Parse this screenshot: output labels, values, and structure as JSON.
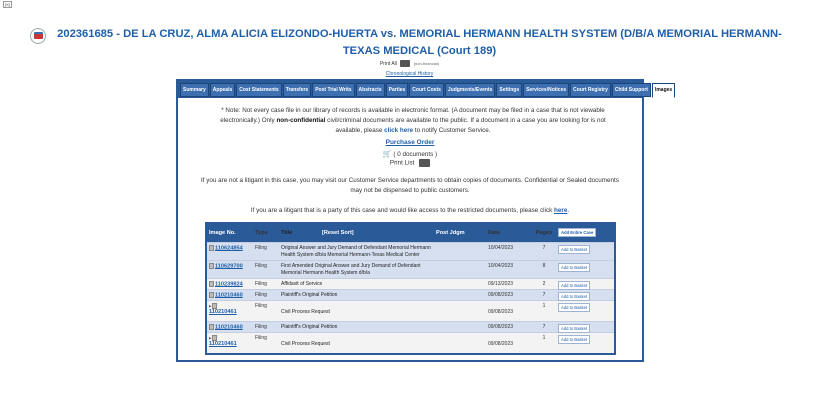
{
  "close_label": "[X]",
  "header": {
    "title": "202361685 - DE LA CRUZ, ALMA ALICIA ELIZONDO-HUERTA vs. MEMORIAL HERMANN HEALTH SYSTEM (D/B/A MEMORIAL HERMANN-TEXAS MEDICAL (Court 189)",
    "print_all": "Print All",
    "print_all_note": "(non-financial)",
    "chronological_history": "Chronological History"
  },
  "tabs": [
    {
      "label": "Summary"
    },
    {
      "label": "Appeals"
    },
    {
      "label": "Cost Statements"
    },
    {
      "label": "Transfers"
    },
    {
      "label": "Post Trial Writs"
    },
    {
      "label": "Abstracts"
    },
    {
      "label": "Parties"
    },
    {
      "label": "Court Costs"
    },
    {
      "label": "Judgments/Events"
    },
    {
      "label": "Settings"
    },
    {
      "label": "Services/Notices"
    },
    {
      "label": "Court Registry"
    },
    {
      "label": "Child Support"
    },
    {
      "label": "Images"
    }
  ],
  "active_tab": "Images",
  "note": {
    "part1": "* Note: Not every case file in our library of records is available in electronic format. (A document may be filed in a case that is not viewable electronically.) Only ",
    "bold": "non-confidential",
    "part2": " civil/criminal documents are available to the public. If a document in a case you are looking for is not available, please ",
    "link": "click here",
    "part3": " to notify Customer Service."
  },
  "purchase_order": "Purchase Order",
  "documents_count": "( 0 documents )",
  "print_list": "Print List",
  "not_litigant": "If you are not a litigant in this case, you may visit our Customer Service departments to obtain copies of documents. Confidential or Sealed documents may not be dispensed to public customers.",
  "litigant": {
    "text": "If you are a litigant that is a party of this case and would like access to the restricted documents, please click ",
    "link": "here",
    "end": "."
  },
  "grid": {
    "headers": {
      "image_no": "Image No.",
      "type": "Type",
      "title": "Title",
      "reset_sort": "[Reset Sort]",
      "post_jdgm": "Post Jdgm",
      "date": "Date",
      "pages": "Pages",
      "add_entire_case": "Add Entire Case"
    },
    "rows": [
      {
        "image": "110624854",
        "type": "Filing",
        "title": "Original Answer and Jury Demand of Defendant Memorial Hermann Health System d/b/a Memorial Hermann-Texas Medical Center",
        "date": "10/04/2023",
        "pages": "7",
        "action": "Add to Basket"
      },
      {
        "image": "110629700",
        "type": "Filing",
        "title": "First Amended Original Answer and Jury Demand of Defendant Memorial Hermann Health System d/b/a",
        "date": "10/04/2023",
        "pages": "8",
        "action": "Add to Basket"
      },
      {
        "image": "110239824",
        "type": "Filing",
        "title": "Affidavit of Service",
        "date": "09/13/2023",
        "pages": "2",
        "action": "Add to Basket"
      },
      {
        "image": "110210460",
        "type": "Filing",
        "title": "Plaintiff's Original Petition",
        "date": "09/08/2023",
        "pages": "7",
        "action": "Add to Basket"
      },
      {
        "image": "110210461",
        "type": "Filing",
        "title": "Civil Process Request",
        "date": "09/08/2023",
        "pages": "1",
        "action": "Add to Basket"
      },
      {
        "image": "110210460",
        "type": "Filing",
        "title": "Plaintiff's Original Petition",
        "date": "09/08/2023",
        "pages": "7",
        "action": "Add to Basket"
      },
      {
        "image": "110210461",
        "type": "Filing",
        "title": "Civil Process Request",
        "date": "09/08/2023",
        "pages": "1",
        "action": "Add to Basket"
      }
    ]
  },
  "colors": {
    "accent": "#2a5a98",
    "link": "#1f5fa8",
    "row_alt": "#d5dff0"
  }
}
